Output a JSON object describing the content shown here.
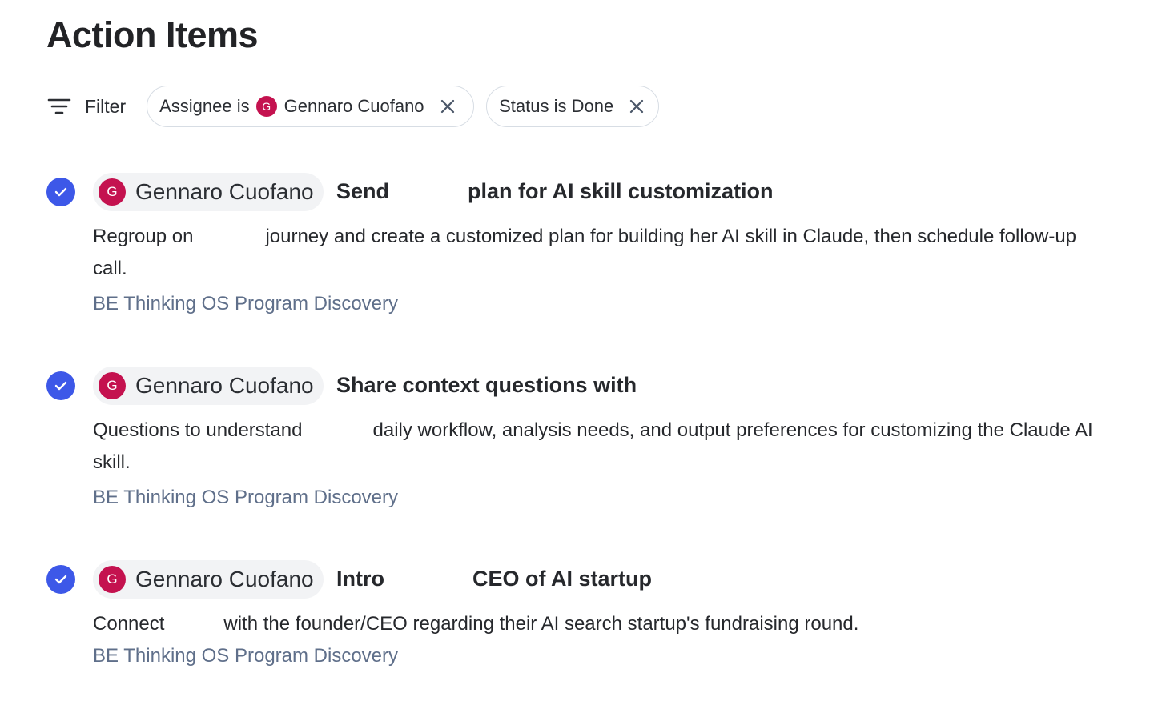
{
  "header": {
    "title": "Action Items"
  },
  "filter_bar": {
    "filter_label": "Filter",
    "chips": [
      {
        "prefix": "Assignee is",
        "avatar_initial": "G",
        "value": "Gennaro Cuofano"
      },
      {
        "prefix": "Status is Done"
      }
    ]
  },
  "colors": {
    "accent": "#3d58e8",
    "avatar": "#c4124f",
    "source_link": "#5f6f8a"
  },
  "items": [
    {
      "status": "done",
      "assignee": {
        "initial": "G",
        "name": "Gennaro Cuofano"
      },
      "title_parts": [
        "Send",
        "plan for AI skill customization"
      ],
      "desc_parts": [
        "Regroup on",
        "journey and create a customized plan for building her AI skill in Claude, then schedule follow-up call."
      ],
      "source": "BE Thinking OS Program Discovery"
    },
    {
      "status": "done",
      "assignee": {
        "initial": "G",
        "name": "Gennaro Cuofano"
      },
      "title_parts": [
        "Share context questions with"
      ],
      "desc_parts": [
        "Questions to understand",
        "daily workflow, analysis needs, and output preferences for customizing the Claude AI skill."
      ],
      "source": "BE Thinking OS Program Discovery"
    },
    {
      "status": "done",
      "assignee": {
        "initial": "G",
        "name": "Gennaro Cuofano"
      },
      "title_parts": [
        "Intro",
        "CEO of AI startup"
      ],
      "desc_parts": [
        "Connect",
        "with the founder/CEO regarding their AI search startup's fundraising round."
      ],
      "source": "BE Thinking OS Program Discovery"
    }
  ]
}
